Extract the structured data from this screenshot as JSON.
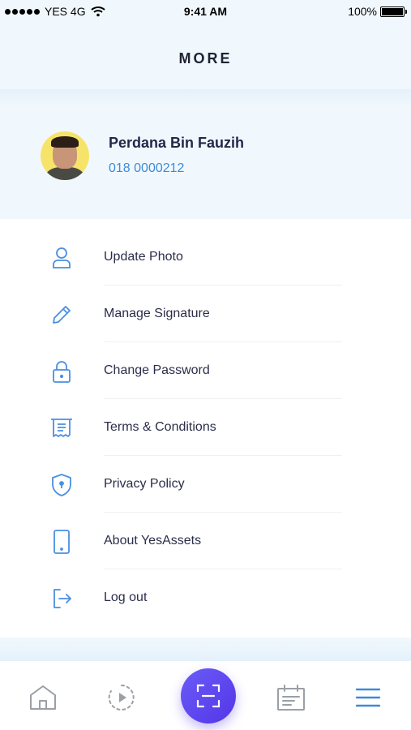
{
  "status_bar": {
    "carrier": "YES 4G",
    "time": "9:41 AM",
    "battery": "100%"
  },
  "header": {
    "title": "MORE"
  },
  "profile": {
    "name": "Perdana Bin Fauzih",
    "phone": "018 0000212"
  },
  "menu": {
    "items": [
      {
        "label": "Update Photo",
        "icon": "user-icon"
      },
      {
        "label": "Manage Signature",
        "icon": "pencil-icon"
      },
      {
        "label": "Change Password",
        "icon": "lock-icon"
      },
      {
        "label": "Terms & Conditions",
        "icon": "receipt-icon"
      },
      {
        "label": "Privacy Policy",
        "icon": "shield-icon"
      },
      {
        "label": "About YesAssets",
        "icon": "phone-icon"
      },
      {
        "label": "Log out",
        "icon": "logout-icon"
      }
    ]
  },
  "tabbar": {
    "tabs": [
      {
        "icon": "home-icon",
        "active": false
      },
      {
        "icon": "history-play-icon",
        "active": false
      },
      {
        "icon": "scan-icon",
        "active": false
      },
      {
        "icon": "calendar-list-icon",
        "active": false
      },
      {
        "icon": "menu-icon",
        "active": true
      }
    ]
  },
  "colors": {
    "accent": "#3d8bd9",
    "icon": "#4a8fe0",
    "header_bg": "#f1f8fd",
    "scan_gradient_start": "#6a5cf7",
    "scan_gradient_end": "#5435e8",
    "tab_inactive": "#9aa0a6"
  }
}
